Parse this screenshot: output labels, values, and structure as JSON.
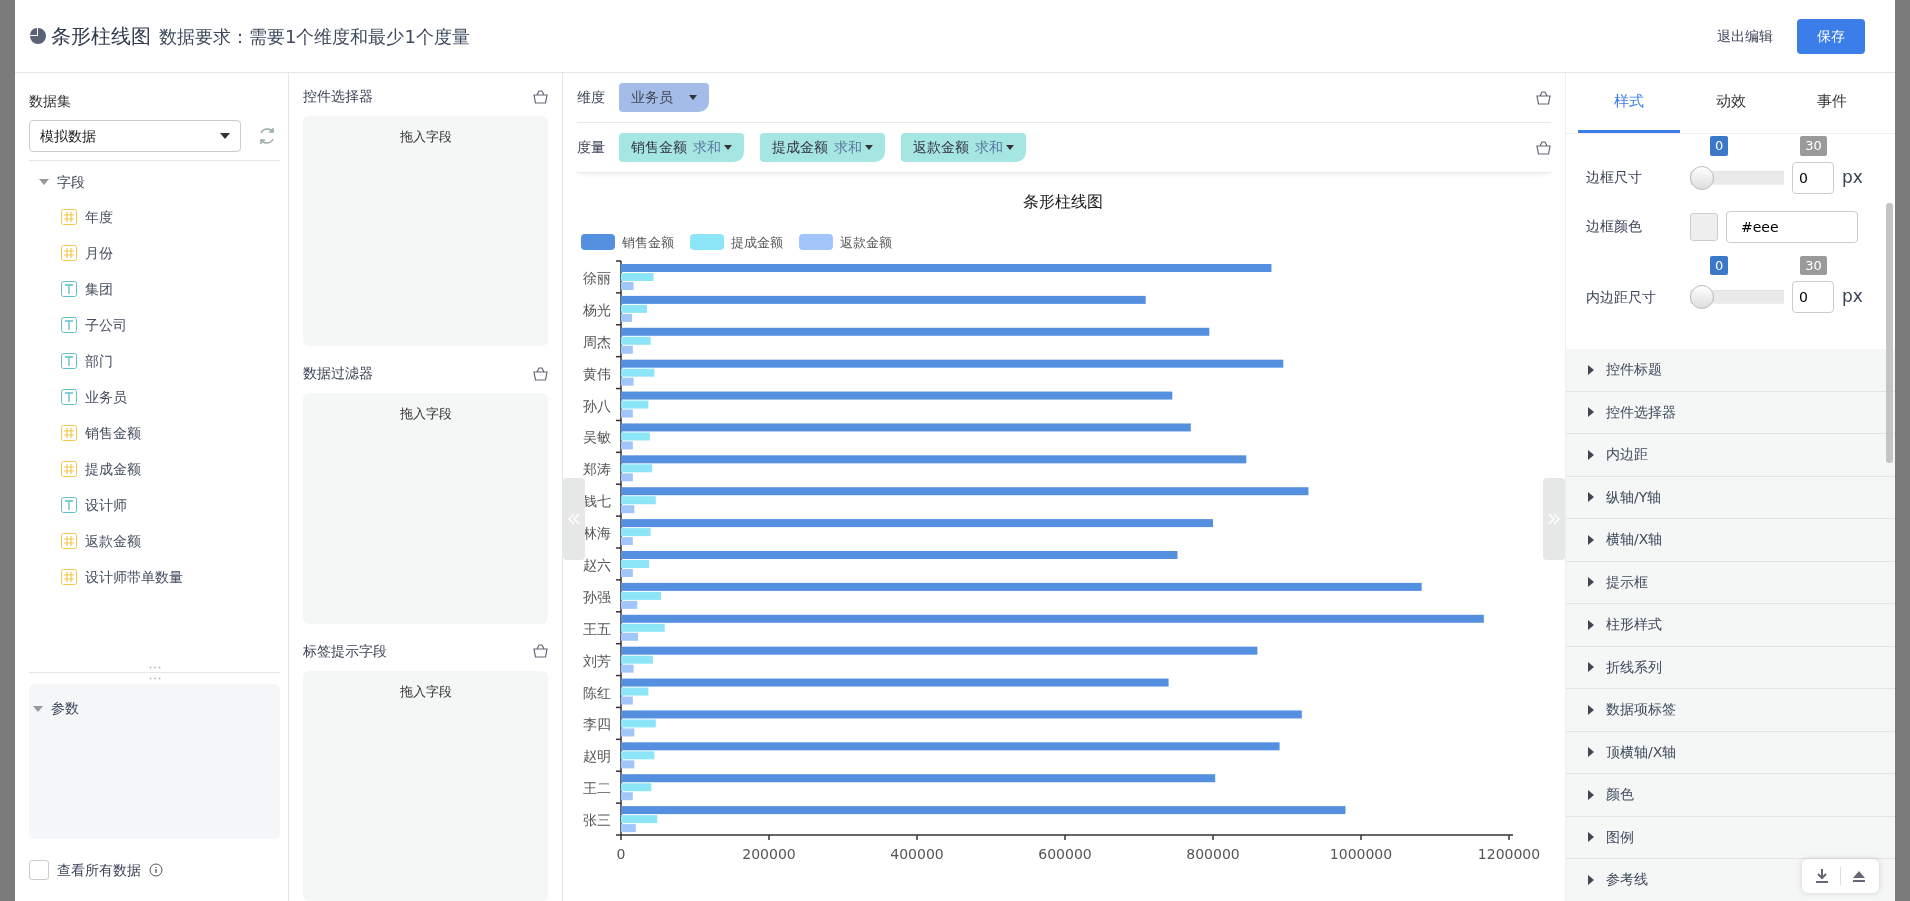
{
  "header": {
    "title": "条形柱线图",
    "requirement": "数据要求：需要1个维度和最少1个度量",
    "exit_link": "退出编辑",
    "save_button": "保存"
  },
  "dataset": {
    "label": "数据集",
    "value": "模拟数据"
  },
  "fields": {
    "label": "字段",
    "expanded": true,
    "children": [
      {
        "name": "年度",
        "kind": "number"
      },
      {
        "name": "月份",
        "kind": "number"
      },
      {
        "name": "集团",
        "kind": "text"
      },
      {
        "name": "子公司",
        "kind": "text"
      },
      {
        "name": "部门",
        "kind": "text"
      },
      {
        "name": "业务员",
        "kind": "text"
      },
      {
        "name": "销售金额",
        "kind": "number"
      },
      {
        "name": "提成金额",
        "kind": "number"
      },
      {
        "name": "设计师",
        "kind": "text"
      },
      {
        "name": "返款金额",
        "kind": "number"
      },
      {
        "name": "设计师带单数量",
        "kind": "number"
      }
    ]
  },
  "params": {
    "label": "参数",
    "expanded": true
  },
  "view_all": {
    "label": "查看所有数据",
    "checked": false
  },
  "drop_zones": [
    {
      "title": "控件选择器",
      "hint": "拖入字段"
    },
    {
      "title": "数据过滤器",
      "hint": "拖入字段"
    },
    {
      "title": "标签提示字段",
      "hint": "拖入字段"
    }
  ],
  "dimension": {
    "label": "维度",
    "chips": [
      {
        "name": "业务员"
      }
    ]
  },
  "measures": {
    "label": "度量",
    "chips": [
      {
        "name": "销售金额",
        "aggregate": "求和"
      },
      {
        "name": "提成金额",
        "aggregate": "求和"
      },
      {
        "name": "返款金额",
        "aggregate": "求和"
      }
    ]
  },
  "chart": {
    "chart_data": {
      "type": "bar",
      "orientation": "horizontal",
      "title": "条形柱线图",
      "categories": [
        "徐丽",
        "杨光",
        "周杰",
        "黄伟",
        "孙八",
        "吴敏",
        "郑涛",
        "钱七",
        "林海",
        "赵六",
        "孙强",
        "王五",
        "刘芳",
        "陈红",
        "李四",
        "赵明",
        "王二",
        "张三"
      ],
      "series": [
        {
          "name": "销售金额",
          "color": "#5590e0",
          "values": [
            879000,
            709000,
            795000,
            895000,
            745000,
            770000,
            845000,
            929000,
            800000,
            752000,
            1082000,
            1166000,
            860000,
            740000,
            920000,
            890000,
            803000,
            979000
          ]
        },
        {
          "name": "提成金额",
          "color": "#8ce6f7",
          "values": [
            44000,
            35000,
            40000,
            45000,
            37000,
            39000,
            42000,
            47000,
            40000,
            38000,
            54000,
            59000,
            43000,
            37000,
            47000,
            45000,
            41000,
            49000
          ]
        },
        {
          "name": "返款金额",
          "color": "#a3c6fa",
          "values": [
            17000,
            15000,
            16000,
            17000,
            16000,
            16000,
            16000,
            18000,
            16000,
            16000,
            22000,
            23000,
            17000,
            16000,
            18000,
            18000,
            16000,
            20000
          ]
        }
      ],
      "legend": true,
      "xlim": [
        0,
        1200000
      ],
      "xticks": [
        0,
        200000,
        400000,
        600000,
        800000,
        1000000,
        1200000
      ]
    }
  },
  "style_panel": {
    "tabs": [
      {
        "label": "样式",
        "selected": true
      },
      {
        "label": "动效",
        "selected": false
      },
      {
        "label": "事件",
        "selected": false
      }
    ],
    "settings": [
      {
        "kind": "slider",
        "label": "边框尺寸",
        "min": "0",
        "max": "30",
        "level": 0,
        "value": "0",
        "unit": "px"
      },
      {
        "kind": "color",
        "label": "边框颜色",
        "color": "#eeeeee",
        "value": "#eee"
      },
      {
        "kind": "slider",
        "label": "内边距尺寸",
        "min": "0",
        "max": "30",
        "level": 0,
        "value": "0",
        "unit": "px"
      }
    ],
    "sections": [
      {
        "label": "控件标题",
        "expanded": false
      },
      {
        "label": "控件选择器",
        "expanded": false
      },
      {
        "label": "内边距",
        "expanded": false
      },
      {
        "label": "纵轴/Y轴",
        "expanded": false
      },
      {
        "label": "横轴/X轴",
        "expanded": false
      },
      {
        "label": "提示框",
        "expanded": false
      },
      {
        "label": "柱形样式",
        "expanded": false
      },
      {
        "label": "折线系列",
        "expanded": false
      },
      {
        "label": "数据项标签",
        "expanded": false
      },
      {
        "label": "顶横轴/X轴",
        "expanded": false
      },
      {
        "label": "颜色",
        "expanded": false
      },
      {
        "label": "图例",
        "expanded": false
      },
      {
        "label": "参考线",
        "expanded": false
      }
    ]
  }
}
